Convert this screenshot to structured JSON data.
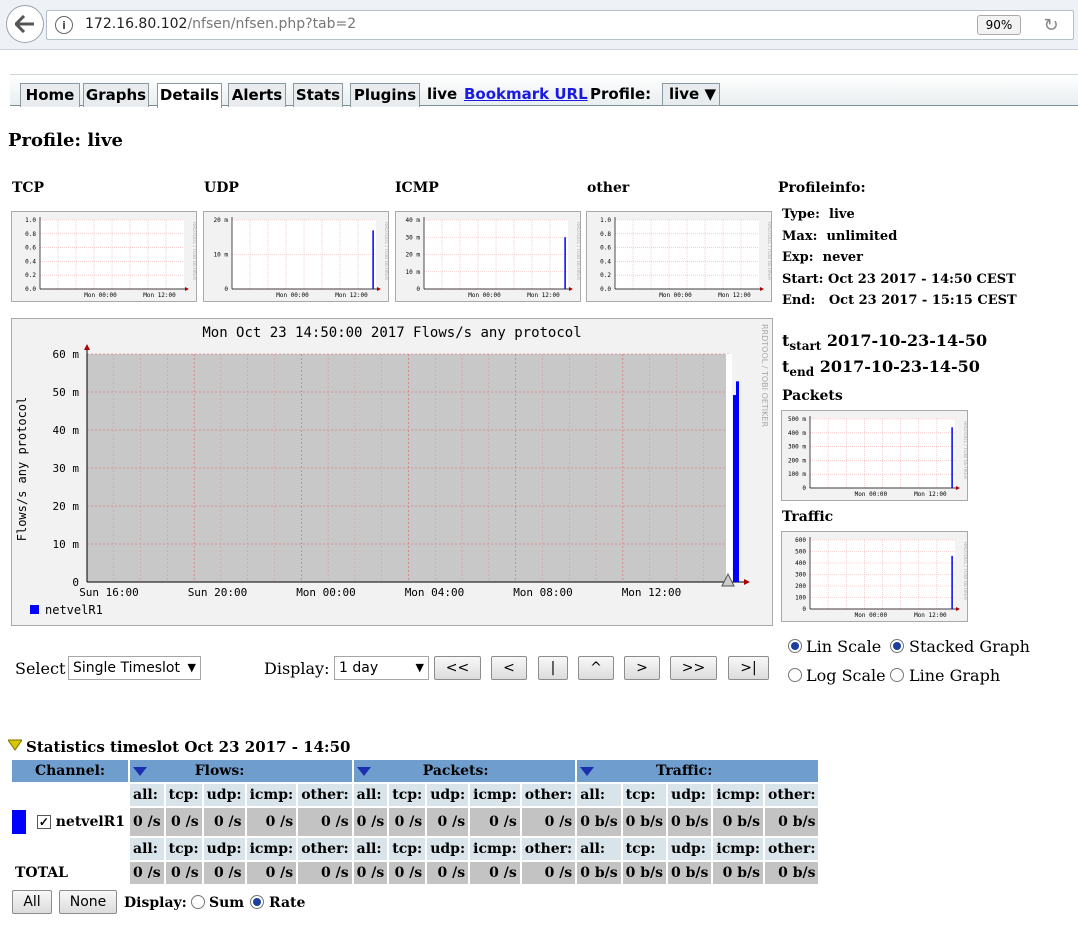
{
  "browser": {
    "url_host": "172.16.80.102",
    "url_path": "/nfsen/nfsen.php?tab=2",
    "zoom": "90%"
  },
  "nav": {
    "tabs": [
      {
        "label": "Home"
      },
      {
        "label": "Graphs"
      },
      {
        "label": "Details"
      },
      {
        "label": "Alerts"
      },
      {
        "label": "Stats"
      },
      {
        "label": "Plugins"
      }
    ],
    "selected_tab": "Details",
    "live_label": "live",
    "bookmark": "Bookmark URL",
    "profile_label": "Profile:",
    "profile_value": "live"
  },
  "page_title": "Profile: live",
  "graph_titles": [
    "TCP",
    "UDP",
    "ICMP",
    "other"
  ],
  "mini_graphs": {
    "tcp": {
      "yticks": [
        "1.0",
        "0.8",
        "0.6",
        "0.4",
        "0.2",
        "0.0"
      ],
      "xticks": [
        "Mon 00:00",
        "Mon 12:00"
      ]
    },
    "udp": {
      "yticks": [
        "20 m",
        "10 m",
        "0"
      ],
      "xticks": [
        "Mon 00:00",
        "Mon 12:00"
      ]
    },
    "icmp": {
      "yticks": [
        "40 m",
        "30 m",
        "20 m",
        "10 m",
        "0"
      ],
      "xticks": [
        "Mon 00:00",
        "Mon 12:00"
      ]
    },
    "other": {
      "yticks": [
        "1.0",
        "0.8",
        "0.6",
        "0.4",
        "0.2",
        "0.0"
      ],
      "xticks": [
        "Mon 00:00",
        "Mon 12:00"
      ]
    },
    "packets": {
      "yticks": [
        "500 m",
        "400 m",
        "300 m",
        "200 m",
        "100 m",
        "0"
      ],
      "xticks": [
        "Mon 00:00",
        "Mon 12:00"
      ]
    },
    "traffic": {
      "yticks": [
        "600",
        "500",
        "400",
        "300",
        "200",
        "100",
        "0"
      ],
      "xticks": [
        "Mon 00:00",
        "Mon 12:00"
      ]
    },
    "watermark": "RRDTOOL / TOBI OETIKER"
  },
  "main_graph": {
    "title": "Mon Oct 23 14:50:00 2017 Flows/s any protocol",
    "ylabel": "Flows/s any protocol",
    "yticks": [
      "60 m",
      "50 m",
      "40 m",
      "30 m",
      "20 m",
      "10 m",
      "0"
    ],
    "xticks": [
      "Sun 16:00",
      "Sun 20:00",
      "Mon 00:00",
      "Mon 04:00",
      "Mon 08:00",
      "Mon 12:00"
    ],
    "legend": "netvelR1",
    "watermark": "RRDTOOL / TOBI OETIKER",
    "series_color": "#0000ff"
  },
  "profileinfo": {
    "heading": "Profileinfo:",
    "rows": [
      {
        "k": "Type:",
        "v": "live"
      },
      {
        "k": "Max:",
        "v": "unlimited"
      },
      {
        "k": "Exp:",
        "v": "never"
      },
      {
        "k": "Start:",
        "v": "Oct 23 2017 - 14:50 CEST"
      },
      {
        "k": "End:",
        "v": "Oct 23 2017 - 15:15 CEST"
      }
    ],
    "tstart_sub": "start",
    "tstart": "2017-10-23-14-50",
    "tend_sub": "end",
    "tend": "2017-10-23-14-50",
    "packets_title": "Packets",
    "traffic_title": "Traffic"
  },
  "controls": {
    "select_label": "Select",
    "select_value": "Single Timeslot",
    "display_label": "Display:",
    "display_value": "1 day",
    "nav_buttons": [
      "<<",
      "<",
      "|",
      "^",
      ">",
      ">>",
      ">|"
    ],
    "scale": {
      "lin": "Lin Scale",
      "log": "Log Scale",
      "stacked": "Stacked Graph",
      "line": "Line Graph"
    }
  },
  "stats": {
    "heading": "Statistics timeslot Oct 23 2017 - 14:50",
    "channel_hdr": "Channel:",
    "flows_hdr": "Flows:",
    "packets_hdr": "Packets:",
    "traffic_hdr": "Traffic:",
    "sub": [
      "all:",
      "tcp:",
      "udp:",
      "icmp:",
      "other:"
    ],
    "channel_name": "netvelR1",
    "channel_color": "#0000ff",
    "flow_vals": [
      "0 /s",
      "0 /s",
      "0 /s",
      "0 /s",
      "0 /s"
    ],
    "packet_vals": [
      "0 /s",
      "0 /s",
      "0 /s",
      "0 /s",
      "0 /s"
    ],
    "traffic_vals": [
      "0 b/s",
      "0 b/s",
      "0 b/s",
      "0 b/s",
      "0 b/s"
    ],
    "total_label": "TOTAL",
    "btn_all": "All",
    "btn_none": "None",
    "display_label": "Display:",
    "sum": "Sum",
    "rate": "Rate"
  }
}
